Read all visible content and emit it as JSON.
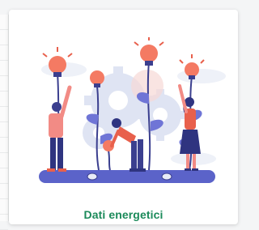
{
  "card": {
    "title": "Dati energetici",
    "illustration_icon": "people-lightbulbs-gears-illustration",
    "title_color": "#1b8a5a"
  }
}
